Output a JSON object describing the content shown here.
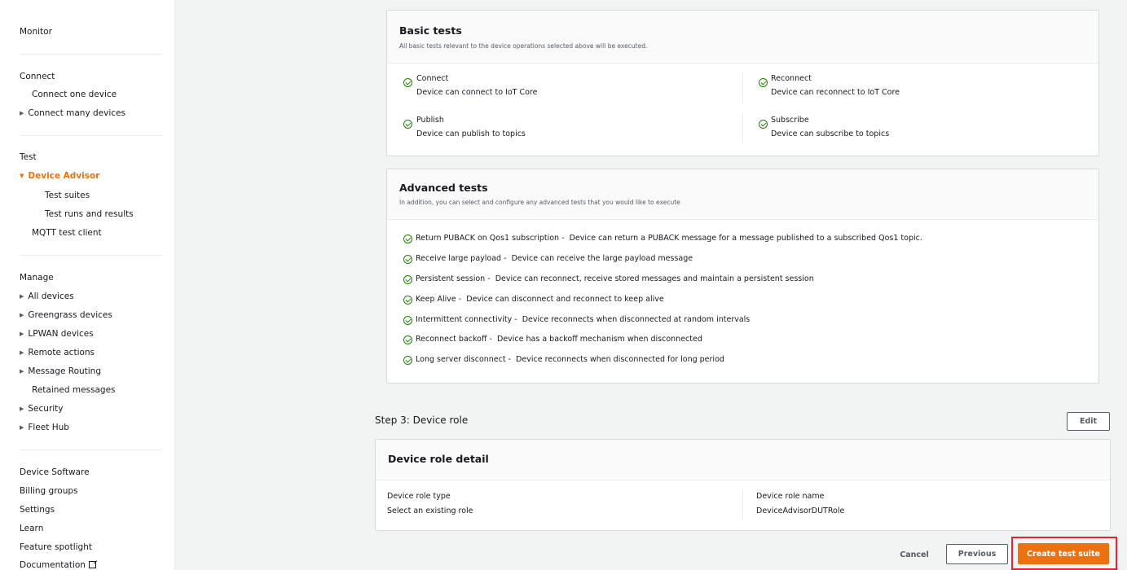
{
  "sidebar": {
    "monitor": "Monitor",
    "connect_header": "Connect",
    "connect_one": "Connect one device",
    "connect_many": "Connect many devices",
    "test_header": "Test",
    "device_advisor": "Device Advisor",
    "test_suites": "Test suites",
    "test_runs": "Test runs and results",
    "mqtt_client": "MQTT test client",
    "manage_header": "Manage",
    "all_devices": "All devices",
    "greengrass": "Greengrass devices",
    "lpwan": "LPWAN devices",
    "remote_actions": "Remote actions",
    "message_routing": "Message Routing",
    "retained_messages": "Retained messages",
    "security": "Security",
    "fleet_hub": "Fleet Hub",
    "device_software": "Device Software",
    "billing_groups": "Billing groups",
    "settings": "Settings",
    "learn": "Learn",
    "feature_spotlight": "Feature spotlight",
    "documentation": "Documentation"
  },
  "basic_tests": {
    "title": "Basic tests",
    "description": "All basic tests relevant to the device operations selected above will be executed.",
    "items": [
      {
        "name": "Connect",
        "desc": "Device can connect to IoT Core"
      },
      {
        "name": "Reconnect",
        "desc": "Device can reconnect to IoT Core"
      },
      {
        "name": "Publish",
        "desc": "Device can publish to topics"
      },
      {
        "name": "Subscribe",
        "desc": "Device can subscribe to topics"
      }
    ]
  },
  "advanced_tests": {
    "title": "Advanced tests",
    "description": "In addition, you can select and configure any advanced tests that you would like to execute",
    "items": [
      {
        "name": "Return PUBACK on Qos1 subscription -",
        "desc": "Device can return a PUBACK message for a message published to a subscribed Qos1 topic."
      },
      {
        "name": "Receive large payload -",
        "desc": "Device can receive the large payload message"
      },
      {
        "name": "Persistent session -",
        "desc": "Device can reconnect, receive stored messages and maintain a persistent session"
      },
      {
        "name": "Keep Alive -",
        "desc": "Device can disconnect and reconnect to keep alive"
      },
      {
        "name": "Intermittent connectivity -",
        "desc": "Device reconnects when disconnected at random intervals"
      },
      {
        "name": "Reconnect backoff -",
        "desc": "Device has a backoff mechanism when disconnected"
      },
      {
        "name": "Long server disconnect -",
        "desc": "Device reconnects when disconnected for long period"
      }
    ]
  },
  "step3": {
    "title": "Step 3: Device role",
    "edit_label": "Edit",
    "card_title": "Device role detail",
    "role_type_label": "Device role type",
    "role_type_value": "Select an existing role",
    "role_name_label": "Device role name",
    "role_name_value": "DeviceAdvisorDUTRole"
  },
  "footer": {
    "cancel": "Cancel",
    "previous": "Previous",
    "create": "Create test suite"
  },
  "colors": {
    "accent": "#ec7211",
    "success": "#1d8102",
    "highlight": "#e5262d"
  }
}
